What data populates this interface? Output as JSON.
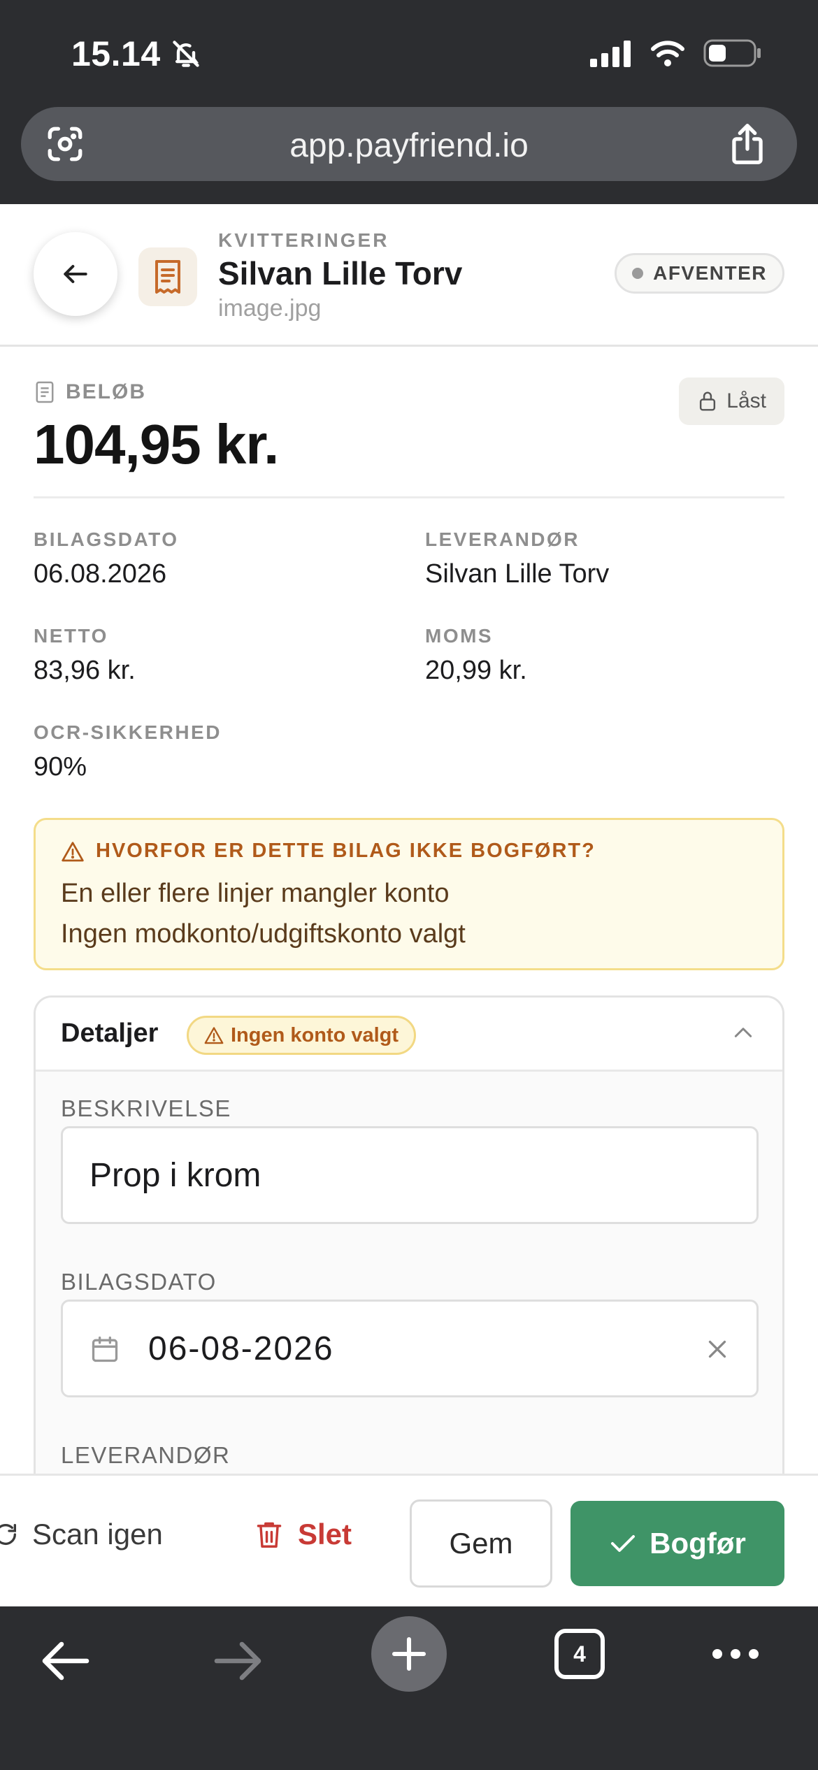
{
  "status_bar": {
    "time": "15.14"
  },
  "browser": {
    "url": "app.payfriend.io",
    "tab_count": "4"
  },
  "header": {
    "breadcrumb": "KVITTERINGER",
    "title": "Silvan Lille Torv",
    "filename": "image.jpg",
    "status": "AFVENTER"
  },
  "summary": {
    "amount_label": "BELØB",
    "amount": "104,95 kr.",
    "lock_label": "Låst",
    "fields": [
      {
        "label": "BILAGSDATO",
        "value": "06.08.2026"
      },
      {
        "label": "LEVERANDØR",
        "value": "Silvan Lille Torv"
      },
      {
        "label": "NETTO",
        "value": "83,96 kr."
      },
      {
        "label": "MOMS",
        "value": "20,99 kr."
      },
      {
        "label": "OCR-SIKKERHED",
        "value": "90%"
      }
    ]
  },
  "warning": {
    "title": "HVORFOR ER DETTE BILAG IKKE BOGFØRT?",
    "lines": [
      "En eller flere linjer mangler konto",
      "Ingen modkonto/udgiftskonto valgt"
    ]
  },
  "details": {
    "title": "Detaljer",
    "tag": "Ingen konto valgt",
    "description_label": "BESKRIVELSE",
    "description_value": "Prop i krom",
    "date_label": "BILAGSDATO",
    "date_value": "06-08-2026",
    "supplier_label": "LEVERANDØR"
  },
  "actions": {
    "scan": "Scan igen",
    "delete": "Slet",
    "save": "Gem",
    "post": "Bogfør"
  },
  "colors": {
    "primary_green": "#3f9467",
    "danger_red": "#c83a35",
    "warning_border": "#f4dd8a",
    "warning_text": "#b05a1a"
  }
}
